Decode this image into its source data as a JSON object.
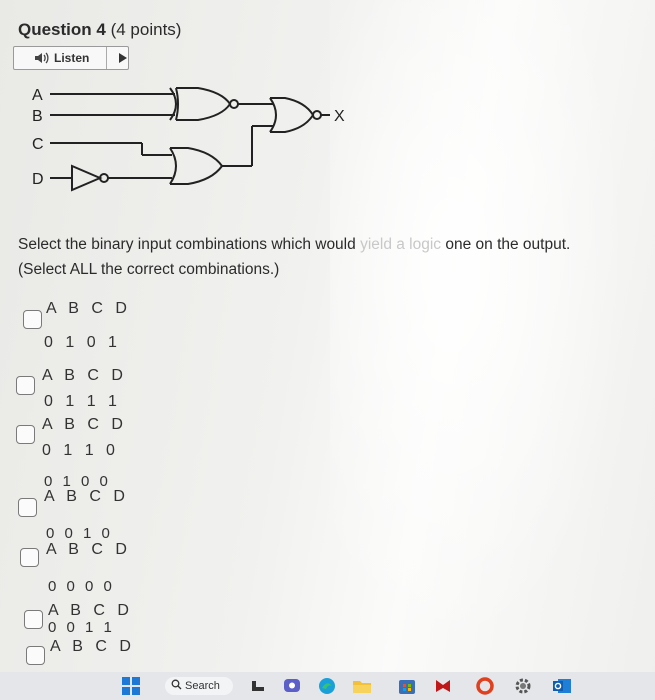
{
  "question": {
    "title": "Question 4",
    "points": "(4 points)"
  },
  "listen": {
    "label": "Listen"
  },
  "circuit": {
    "inputs": [
      "A",
      "B",
      "C",
      "D"
    ],
    "output": "X"
  },
  "prompt": {
    "line1_a": "Select the binary input combinations which would ",
    "line1_b": "yield a logic",
    "line1_c": " one on the output.",
    "line2": "(Select ALL the correct combinations.)"
  },
  "options": [
    {
      "header": "ABCD",
      "value": "0101"
    },
    {
      "header": "ABCD",
      "value": "0111"
    },
    {
      "header": "ABCD",
      "value": "0110"
    },
    {
      "header": "ABCD",
      "value": "0100"
    },
    {
      "header": "ABCD",
      "value": "0010"
    },
    {
      "header": "ABCD",
      "value": "0000"
    },
    {
      "header": "ABCD",
      "value": "0011"
    }
  ],
  "lines": {
    "o1_head": "A B C D",
    "o1_val": "0 1  0  1",
    "o2_head": "A B C D",
    "o2_val": "0 1  1  1",
    "o3_head": "A B C D",
    "o3_val": "0 1  1  0",
    "o4_val": "0 1 0 0",
    "o4_head": "A B C D",
    "o5_val": "0 0 1 0",
    "o5_head": "A B C D",
    "o6_val": "0 0 0 0",
    "o6_head": "A B C D",
    "o7_val": "0 0 1  1",
    "o7_head": "A B C D"
  },
  "taskbar": {
    "search_label": "Search"
  }
}
